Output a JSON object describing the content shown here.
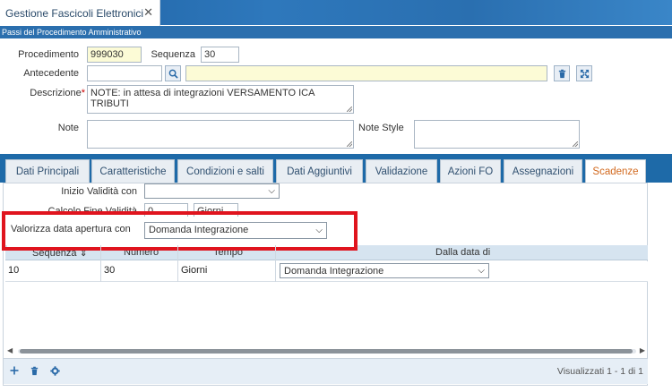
{
  "window": {
    "tab_title": "Gestione Fascicoli Elettronici",
    "close_glyph": "✕",
    "subheader": "Passi del Procedimento Amministrativo"
  },
  "form": {
    "procedimento_label": "Procedimento",
    "procedimento_value": "999030",
    "sequenza_label": "Sequenza",
    "sequenza_value": "30",
    "antecedente_label": "Antecedente",
    "antecedente_value": "",
    "antecedente_desc": "",
    "descrizione_label": "Descrizione",
    "descrizione_required": "*",
    "descrizione_value": "NOTE: in attesa di integrazioni VERSAMENTO ICA TRIBUTI",
    "note_label": "Note",
    "note_value": "",
    "note_style_label": "Note Style",
    "note_style_value": ""
  },
  "icons": {
    "search": "search-icon",
    "delete": "trash-icon",
    "expand": "expand-icon"
  },
  "tabs": [
    {
      "label": "Dati Principali",
      "active": false
    },
    {
      "label": "Caratteristiche",
      "active": false
    },
    {
      "label": "Condizioni e salti",
      "active": false
    },
    {
      "label": "Dati Aggiuntivi",
      "active": false
    },
    {
      "label": "Validazione",
      "active": false
    },
    {
      "label": "Azioni FO",
      "active": false
    },
    {
      "label": "Assegnazioni",
      "active": false
    },
    {
      "label": "Scadenze",
      "active": true
    }
  ],
  "scadenze": {
    "inizio_validita_label": "Inizio Validità con",
    "inizio_validita_value": "",
    "calcolo_fine_label": "Calcolo Fine Validità",
    "calcolo_fine_num": "0",
    "calcolo_fine_unit": "Giorni",
    "valorizza_label": "Valorizza data apertura con",
    "valorizza_value": "Domanda Integrazione",
    "accent_color": "#d2691e",
    "highlight_color": "#e0141e"
  },
  "grid": {
    "headers": [
      "Sequenza",
      "Numero",
      "Tempo",
      "Dalla data di"
    ],
    "sort_glyph": "⇕",
    "rows": [
      {
        "sequenza": "10",
        "numero": "30",
        "tempo": "Giorni",
        "dalla_data": "Domanda Integrazione"
      }
    ],
    "pager": "Visualizzati 1 - 1 di 1"
  }
}
